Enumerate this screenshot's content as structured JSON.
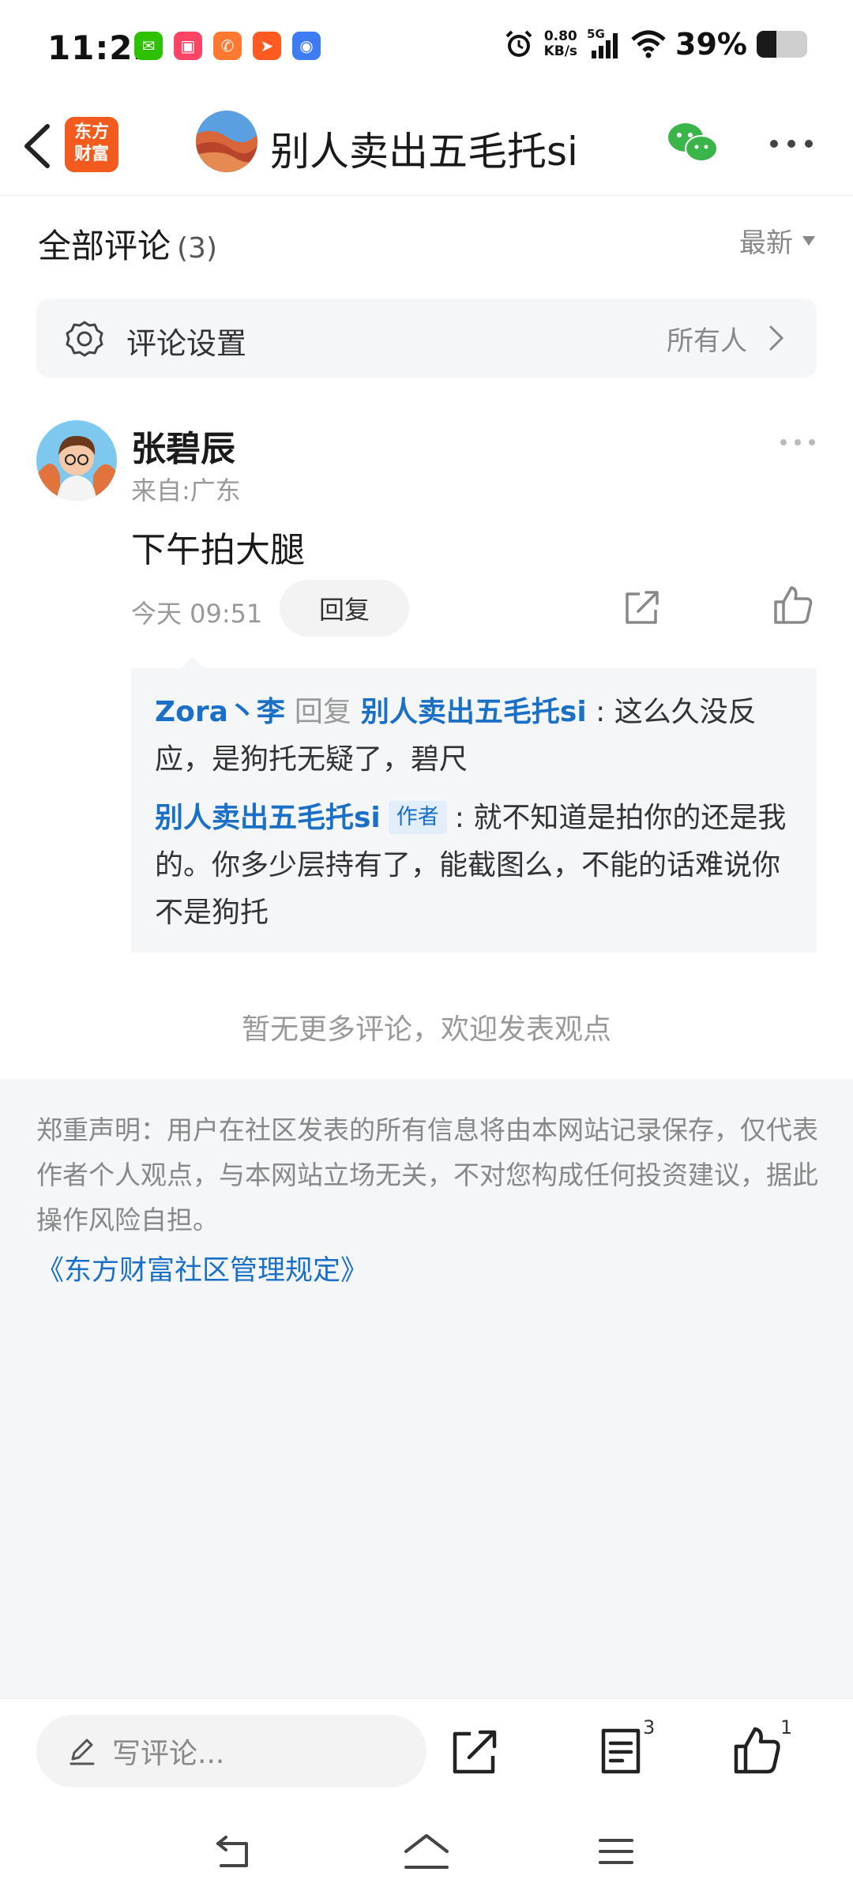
{
  "status_bar": {
    "time": "11:22",
    "net_speed_value": "0.80",
    "net_speed_unit": "KB/s",
    "network": "5G",
    "battery_percent": "39%",
    "battery_level": 0.39,
    "notification_icons": [
      "wechat-icon",
      "taobao-icon",
      "phone-app-icon",
      "feishu-icon",
      "browser-icon"
    ]
  },
  "header": {
    "logo_line1": "东方",
    "logo_line2": "财富",
    "title": "别人卖出五毛托si",
    "accent_color": "#f25a1e"
  },
  "comments_header": {
    "title": "全部评论",
    "count": "(3)",
    "sort_label": "最新"
  },
  "settings": {
    "label": "评论设置",
    "value": "所有人"
  },
  "comment": {
    "user_name": "张碧辰",
    "location": "来自:广东",
    "text": "下午拍大腿",
    "time": "今天 09:51",
    "reply_label": "回复"
  },
  "replies": [
    {
      "from": "Zora丶李",
      "verb": "回复",
      "to": "别人卖出五毛托si",
      "text": ": 这么久没反应，是狗托无疑了，碧尺"
    },
    {
      "from": "别人卖出五毛托si",
      "tag": "作者",
      "text": ": 就不知道是拍你的还是我的。你多少层持有了，能截图么，不能的话难说你不是狗托"
    }
  ],
  "no_more": "暂无更多评论，欢迎发表观点",
  "disclaimer": {
    "text": "郑重声明：用户在社区发表的所有信息将由本网站记录保存，仅代表作者个人观点，与本网站立场无关，不对您构成任何投资建议，据此操作风险自担。",
    "link": "《东方财富社区管理规定》",
    "link_color": "#1a6fc6"
  },
  "toolbar": {
    "input_placeholder": "写评论...",
    "comments_badge": "3",
    "likes_badge": "1"
  }
}
